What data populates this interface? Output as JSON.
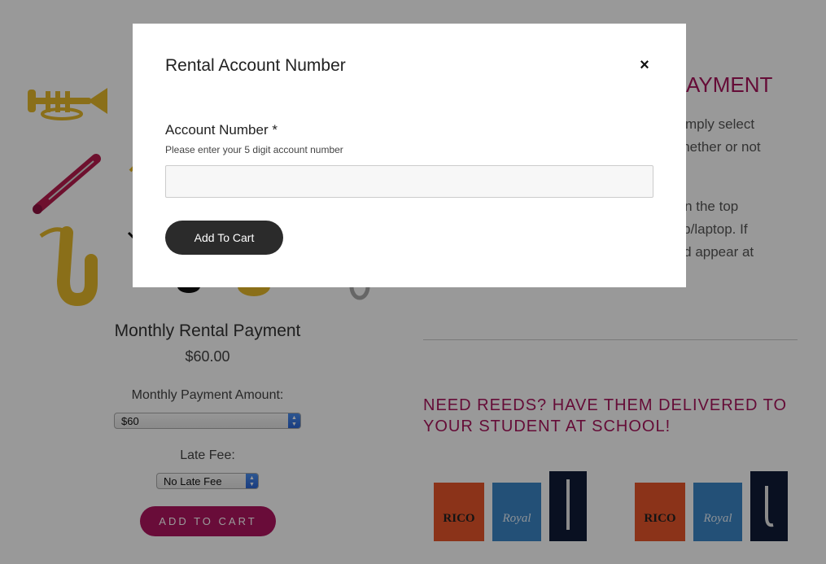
{
  "modal": {
    "title": "Rental Account Number",
    "close_glyph": "×",
    "field_label": "Account Number *",
    "field_help": "Please enter your 5 digit account number",
    "field_value": "",
    "field_placeholder": "",
    "submit_label": "Add To Cart"
  },
  "product": {
    "title": "Monthly Rental Payment",
    "price": "$60.00",
    "payment_amount_label": "Monthly Payment Amount:",
    "payment_amount_selected": "$60",
    "late_fee_label": "Late Fee:",
    "late_fee_selected": "No Late Fee",
    "add_to_cart_label": "ADD TO CART"
  },
  "info": {
    "heading_fragment": "AYMENT",
    "text_lines": [
      "e. Simply select",
      "ct whether or not",
      "ear in the top",
      "sktop/laptop. If",
      "hould appear at"
    ]
  },
  "reeds": {
    "heading_line1": "NEED REEDS? HAVE THEM DELIVERED TO",
    "heading_line2": "YOUR STUDENT AT SCHOOL!",
    "box_brands": [
      "RICO",
      "Royal",
      "RICO",
      "Royal"
    ]
  },
  "icons": [
    "trumpet-icon",
    "clarinet-icon",
    "saxophone-icon",
    "close-icon",
    "select-arrows-icon"
  ],
  "colors": {
    "accent": "#a8155c",
    "button_dark": "#2b2b2b",
    "brass": "#e6b92a",
    "overlay": "rgba(0,0,0,0.40)"
  }
}
